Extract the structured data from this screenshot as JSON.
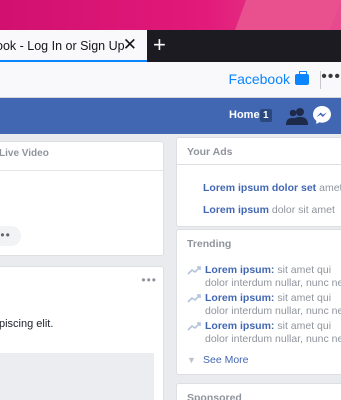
{
  "browser": {
    "tab_title": "ook - Log In or Sign Up",
    "close_glyph": "✕",
    "newtab_glyph": "+",
    "bookmark_label": "Facebook",
    "more_glyph": "•••",
    "accent": "#0a84ff"
  },
  "fb": {
    "home_label": "Home",
    "home_count": "1",
    "brand_color": "#4267b2"
  },
  "composer": {
    "live_video": "Live Video",
    "options_glyph": "•••"
  },
  "post": {
    "more_glyph": "•••",
    "text": "piscing elit."
  },
  "ads": {
    "title": "Your Ads",
    "items": [
      {
        "bold": "Lorem ipsum dolor set",
        "rest": " amet"
      },
      {
        "bold": "Lorem ipsum",
        "rest": " dolor sit amet"
      }
    ]
  },
  "trending": {
    "title": "Trending",
    "items": [
      {
        "bold": "Lorem ipsum:",
        "rest": " sit amet qui",
        "line2": "dolor interdum nullar, nunc nec"
      },
      {
        "bold": "Lorem ipsum:",
        "rest": " sit amet qui",
        "line2": "dolor interdum nullar, nunc nec"
      },
      {
        "bold": "Lorem ipsum:",
        "rest": " sit amet qui",
        "line2": "dolor interdum nullar, nunc nec"
      }
    ],
    "see_more": "See More"
  },
  "sponsored": {
    "title": "Sponsored"
  }
}
